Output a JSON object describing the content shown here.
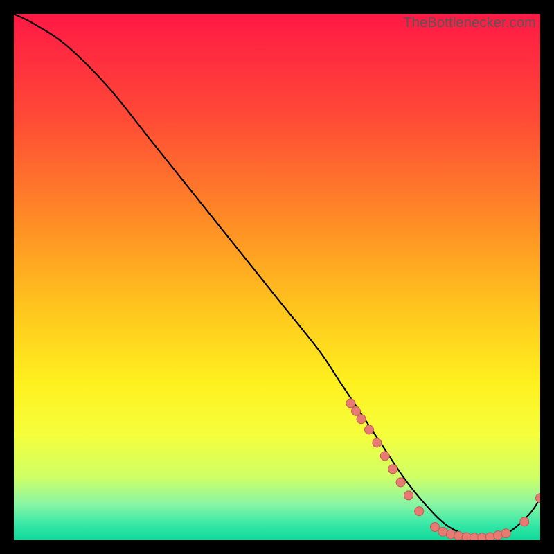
{
  "watermark": "TheBottlenecker.com",
  "colors": {
    "gradient_stops": [
      {
        "offset": 0.0,
        "color": "#ff1945"
      },
      {
        "offset": 0.2,
        "color": "#ff4b36"
      },
      {
        "offset": 0.4,
        "color": "#ff8e25"
      },
      {
        "offset": 0.55,
        "color": "#ffc21e"
      },
      {
        "offset": 0.7,
        "color": "#fff01f"
      },
      {
        "offset": 0.8,
        "color": "#f5ff3c"
      },
      {
        "offset": 0.88,
        "color": "#cfff66"
      },
      {
        "offset": 0.93,
        "color": "#8cf6a3"
      },
      {
        "offset": 0.97,
        "color": "#37e8a7"
      },
      {
        "offset": 1.0,
        "color": "#0fd99a"
      }
    ],
    "curve": "#000000",
    "marker_fill": "#e77b74",
    "marker_stroke": "#c35a53",
    "background": "#000000"
  },
  "chart_data": {
    "type": "line",
    "title": "",
    "xlabel": "",
    "ylabel": "",
    "xlim": [
      0,
      100
    ],
    "ylim": [
      0,
      100
    ],
    "grid": false,
    "legend": false,
    "series": [
      {
        "name": "bottleneck-curve",
        "x": [
          0,
          4,
          10,
          18,
          26,
          34,
          42,
          50,
          58,
          62,
          66,
          70,
          74,
          78,
          82,
          86,
          90,
          94,
          98,
          100
        ],
        "y": [
          100,
          98,
          94,
          86,
          76,
          66,
          56,
          46,
          36,
          30,
          24,
          18,
          12,
          7,
          3,
          1,
          0.5,
          1.5,
          5,
          8
        ]
      }
    ],
    "markers": [
      {
        "x": 64,
        "y": 26
      },
      {
        "x": 65,
        "y": 24.5
      },
      {
        "x": 66,
        "y": 23
      },
      {
        "x": 67.5,
        "y": 21
      },
      {
        "x": 69,
        "y": 18.5
      },
      {
        "x": 70.5,
        "y": 16
      },
      {
        "x": 72,
        "y": 13.5
      },
      {
        "x": 73.5,
        "y": 11
      },
      {
        "x": 75,
        "y": 8.5
      },
      {
        "x": 77,
        "y": 5.5
      },
      {
        "x": 80,
        "y": 2.5
      },
      {
        "x": 81.5,
        "y": 1.6
      },
      {
        "x": 83,
        "y": 1.1
      },
      {
        "x": 84.5,
        "y": 0.8
      },
      {
        "x": 86,
        "y": 0.6
      },
      {
        "x": 87.5,
        "y": 0.5
      },
      {
        "x": 89,
        "y": 0.5
      },
      {
        "x": 90.5,
        "y": 0.6
      },
      {
        "x": 92,
        "y": 0.9
      },
      {
        "x": 93.5,
        "y": 1.3
      },
      {
        "x": 97,
        "y": 3.5
      },
      {
        "x": 100,
        "y": 8
      }
    ]
  }
}
